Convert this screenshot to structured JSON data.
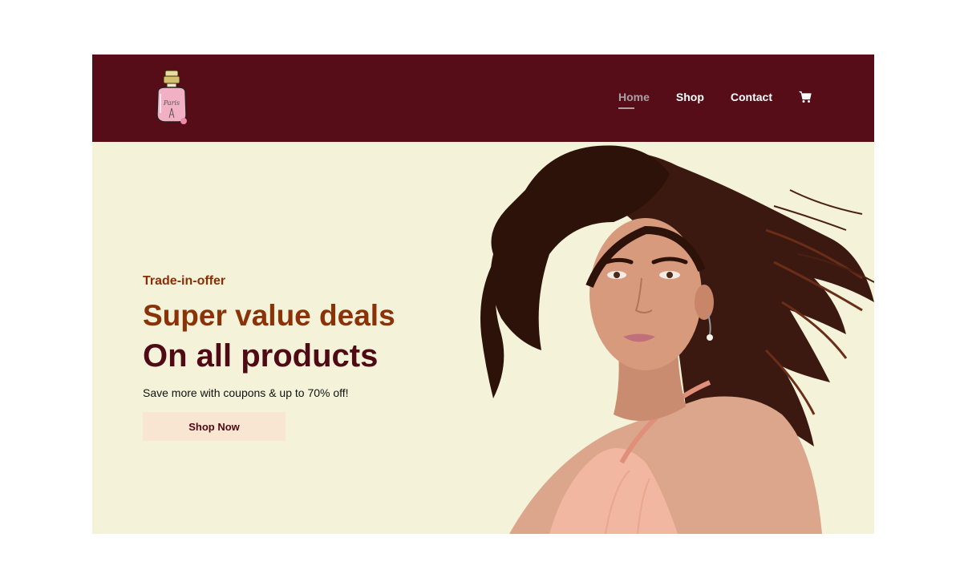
{
  "header": {
    "logo_icon": "perfume-bottle-logo-icon",
    "nav": [
      {
        "label": "Home",
        "active": true
      },
      {
        "label": "Shop",
        "active": false
      },
      {
        "label": "Contact",
        "active": false
      }
    ],
    "cart_icon": "shopping-cart-icon"
  },
  "hero": {
    "eyebrow": "Trade-in-offer",
    "headline_1": "Super value deals",
    "headline_2": "On all products",
    "subtext": "Save more with coupons & up to 70% off!",
    "cta_label": "Shop Now",
    "image": "woman-with-wavy-hair-portrait"
  },
  "colors": {
    "header_bg": "#560d18",
    "hero_bg": "#f4f3da",
    "accent_orange": "#8a3208",
    "accent_maroon": "#4f0a16",
    "button_bg": "#f8e5d2"
  }
}
